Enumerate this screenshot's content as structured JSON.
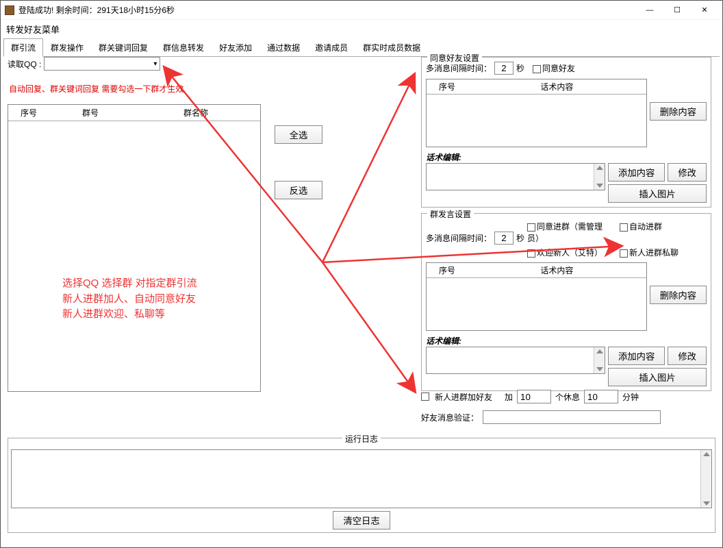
{
  "titlebar": {
    "text": "登陆成功! 剩余时间：291天18小时15分6秒"
  },
  "subtitle": "转发好友菜单",
  "tabs": [
    "群引流",
    "群发操作",
    "群关键词回复",
    "群信息转发",
    "好友添加",
    "通过数据",
    "邀请成员",
    "群实时成员数据"
  ],
  "left": {
    "readqq_label": "读取QQ :",
    "redtext": "自动回复、群关键词回复 需要勾选一下群才生效",
    "cols": {
      "c1": "序号",
      "c2": "群号",
      "c3": "群名称"
    }
  },
  "sidebtns": {
    "selectAll": "全选",
    "invert": "反选"
  },
  "friend": {
    "legend": "同意好友设置",
    "interval_label": "多消息间隔时间：",
    "interval_val": "2",
    "unit": "秒",
    "agree_label": "同意好友",
    "cols": {
      "c1": "序号",
      "c2": "话术内容"
    },
    "delete": "删除内容",
    "edit_label": "话术编辑:",
    "add": "添加内容",
    "modify": "修改",
    "insert_img": "插入图片"
  },
  "groupmsg": {
    "legend": "群发言设置",
    "interval_label": "多消息间隔时间：",
    "interval_val": "2",
    "unit": "秒",
    "chk1": "同意进群（需管理员）",
    "chk2": "自动进群",
    "chk3": "欢迎新人（艾特）",
    "chk4": "新人进群私聊",
    "cols": {
      "c1": "序号",
      "c2": "话术内容"
    },
    "delete": "删除内容",
    "edit_label": "话术编辑:",
    "add": "添加内容",
    "modify": "修改",
    "insert_img": "插入图片"
  },
  "bottom": {
    "addfriend_chk": "新人进群加好友",
    "add_lbl": "加",
    "add_val": "10",
    "rest_lbl": "个休息",
    "rest_val": "10",
    "minutes": "分钟",
    "verify_label": "好友消息验证："
  },
  "log": {
    "legend": "运行日志",
    "clear": "清空日志"
  },
  "annotation": {
    "l1": "选择QQ 选择群 对指定群引流",
    "l2": "新人进群加人、自动同意好友",
    "l3": "新人进群欢迎、私聊等"
  }
}
